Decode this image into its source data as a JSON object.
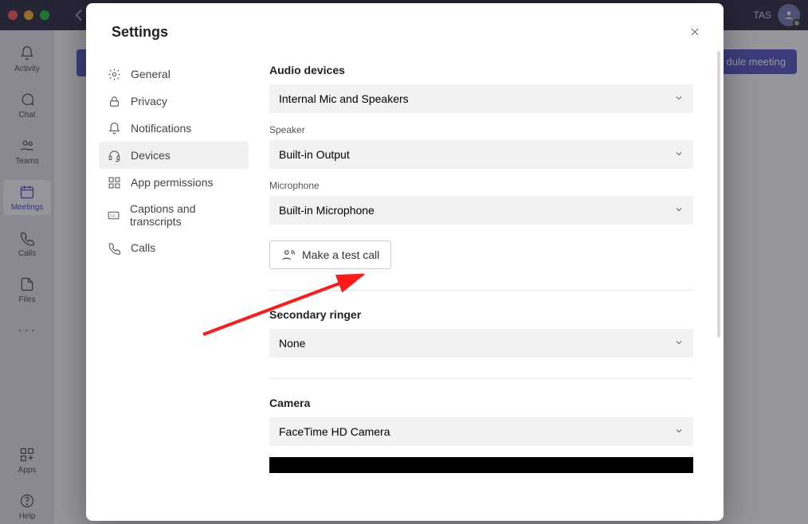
{
  "titlebar": {
    "user_initials": "TAS"
  },
  "rail": {
    "items": [
      {
        "label": "Activity"
      },
      {
        "label": "Chat"
      },
      {
        "label": "Teams"
      },
      {
        "label": "Meetings"
      },
      {
        "label": "Calls"
      },
      {
        "label": "Files"
      }
    ],
    "apps_label": "Apps",
    "help_label": "Help"
  },
  "background": {
    "right_button": "dule meeting"
  },
  "modal": {
    "title": "Settings",
    "nav": [
      {
        "label": "General"
      },
      {
        "label": "Privacy"
      },
      {
        "label": "Notifications"
      },
      {
        "label": "Devices"
      },
      {
        "label": "App permissions"
      },
      {
        "label": "Captions and transcripts"
      },
      {
        "label": "Calls"
      }
    ],
    "content": {
      "audio_title": "Audio devices",
      "audio_select": "Internal Mic and Speakers",
      "speaker_label": "Speaker",
      "speaker_select": "Built-in Output",
      "mic_label": "Microphone",
      "mic_select": "Built-in Microphone",
      "test_call": "Make a test call",
      "secondary_title": "Secondary ringer",
      "secondary_select": "None",
      "camera_title": "Camera",
      "camera_select": "FaceTime HD Camera"
    }
  }
}
